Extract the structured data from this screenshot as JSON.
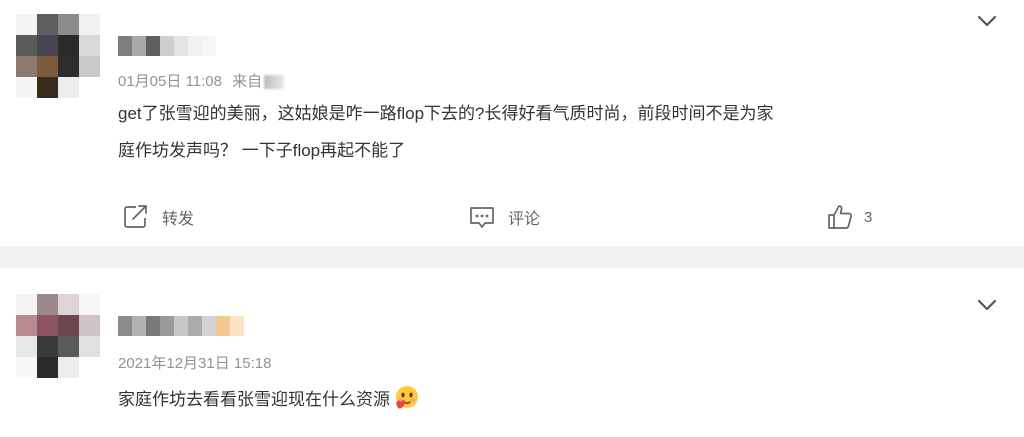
{
  "posts": [
    {
      "timestamp": "01月05日 11:08",
      "source_prefix": "来自",
      "text_line1": "get了张雪迎的美丽，这姑娘是咋一路flop下去的?长得好看气质时尚，前段时间不是为家",
      "text_line2": "庭作坊发声吗？ 一下子flop再起不能了",
      "actions": {
        "repost_label": "转发",
        "comment_label": "评论",
        "like_count": "3"
      }
    },
    {
      "timestamp": "2021年12月31日 15:18",
      "text_line1": "家庭作坊去看看张雪迎现在什么资源"
    }
  ],
  "icons": {
    "expand": "chevron-down-icon",
    "repost": "repost-icon",
    "comment": "comment-icon",
    "like": "thumbs-up-icon",
    "emoji": "emoji-icon"
  },
  "colors": {
    "text": "#333333",
    "meta": "#939393",
    "action": "#666666",
    "separator": "#f2f2f2"
  }
}
